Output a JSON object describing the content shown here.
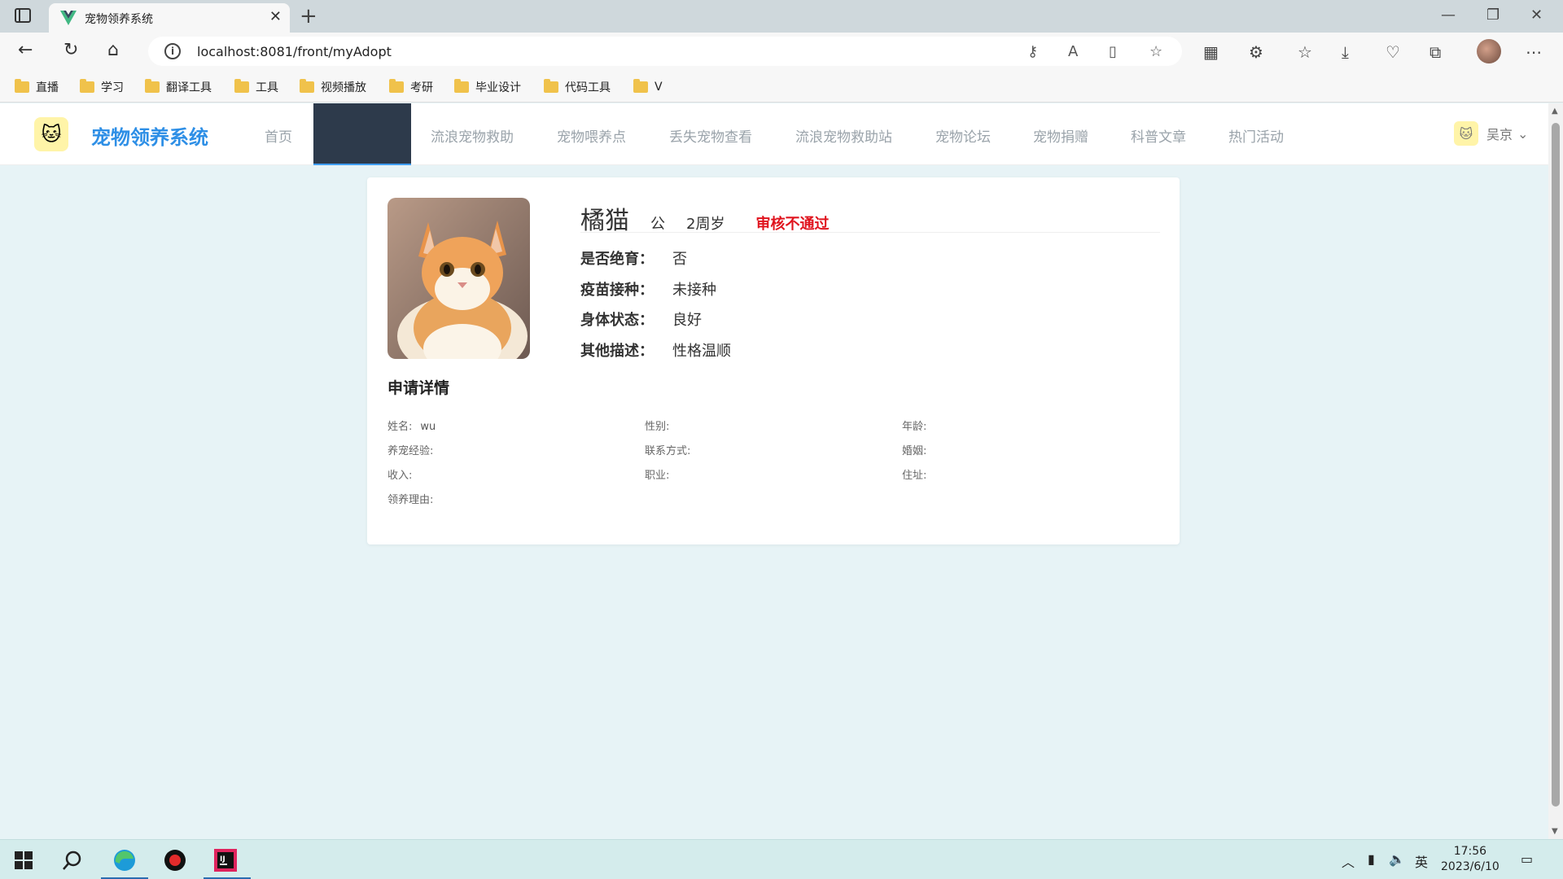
{
  "browser": {
    "tab_title": "宠物领养系统",
    "url": "localhost:8081/front/myAdopt",
    "bookmarks": [
      "直播",
      "学习",
      "翻译工具",
      "工具",
      "视频播放",
      "考研",
      "毕业设计",
      "代码工具",
      "V"
    ]
  },
  "site": {
    "title": "宠物领养系统",
    "nav": [
      "首页",
      "流浪宠物救助",
      "宠物喂养点",
      "丢失宠物查看",
      "流浪宠物救助站",
      "宠物论坛",
      "宠物捐赠",
      "科普文章",
      "热门活动"
    ],
    "user_name": "吴京"
  },
  "pet": {
    "name": "橘猫",
    "sex": "公",
    "age": "2周岁",
    "status": "审核不通过",
    "status_color": "#e0141e",
    "details": [
      {
        "label": "是否绝育：",
        "value": "否"
      },
      {
        "label": "疫苗接种：",
        "value": "未接种"
      },
      {
        "label": "身体状态：",
        "value": "良好"
      },
      {
        "label": "其他描述：",
        "value": "性格温顺"
      }
    ]
  },
  "application": {
    "section_title": "申请详情",
    "fields": [
      {
        "label": "姓名:",
        "value": "wu"
      },
      {
        "label": "性别:",
        "value": ""
      },
      {
        "label": "年龄:",
        "value": ""
      },
      {
        "label": "养宠经验:",
        "value": ""
      },
      {
        "label": "联系方式:",
        "value": ""
      },
      {
        "label": "婚姻:",
        "value": ""
      },
      {
        "label": "收入:",
        "value": ""
      },
      {
        "label": "职业:",
        "value": ""
      },
      {
        "label": "住址:",
        "value": ""
      },
      {
        "label": "领养理由:",
        "value": ""
      }
    ]
  },
  "taskbar": {
    "ime": "英",
    "time": "17:56",
    "date": "2023/6/10"
  },
  "colors": {
    "accent": "#2e8fe6",
    "nav_active_bg": "#2d3a4b",
    "page_bg": "#e7f3f6"
  }
}
